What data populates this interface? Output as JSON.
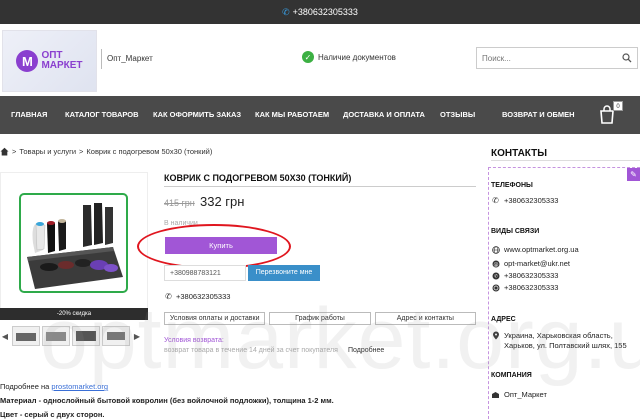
{
  "topbar": {
    "phone": "+380632305333"
  },
  "header": {
    "logo_text_1": "ОПТ",
    "logo_text_2": "МАРКЕТ",
    "brand_name": "Опт_Маркет",
    "docs_label": "Наличие документов",
    "search_placeholder": "Поиск..."
  },
  "nav": {
    "items": [
      "Главная",
      "Каталог товаров",
      "Как оформить заказ",
      "Как мы работаем",
      "Доставка и оплата",
      "Отзывы",
      "Возврат и обмен"
    ],
    "cart_count": "0"
  },
  "breadcrumb": {
    "level1": "Товары и услуги",
    "sep": ">",
    "current": "Коврик с подогревом 50х30 (тонкий)"
  },
  "product": {
    "title": "Коврик с подогревом 50х30 (тонкий)",
    "old_price": "415 грн",
    "price": "332 грн",
    "stock": "В наличии",
    "buy_label": "Купить",
    "phone_input_value": "+380988783121",
    "callback_label": "Перезвоните мне",
    "phone": "+380632305333",
    "discount_label": "-20% скидка",
    "tabs": [
      "Условия оплаты и доставки",
      "График работы",
      "Адрес и контакты"
    ],
    "return_title": "Условия возврата:",
    "return_text": "возврат товара в течение 14 дней за счет покупателя",
    "return_more": "Подробнее"
  },
  "description": {
    "source_prefix": "Подробнее на",
    "source_link": "prostomarket.org",
    "material": "Материал - однослойный бытовой ковролин (без войлочной подложки), толщина 1-2 мм.",
    "color": "Цвет - серый с двух сторон."
  },
  "sidebar": {
    "title": "Контакты",
    "phones_title": "Телефоны",
    "phone": "+380632305333",
    "links_title": "Виды связи",
    "site": "www.optmarket.org.ua",
    "email": "opt-market@ukr.net",
    "viber": "+380632305333",
    "whatsapp": "+380632305333",
    "address_title": "Адрес",
    "address": "Украина, Харьковская область, Харьков, ул. Полтавский шлях, 155",
    "company_title": "Компания",
    "company": "Опт_Маркет"
  },
  "watermark": "optmarket.org.ua",
  "colors": {
    "accent": "#a156d6",
    "nav_bg": "#4a4a4a",
    "topbar_bg": "#333333",
    "callback": "#3a8fc9",
    "annotation": "#e0161f"
  },
  "icons": [
    "phone-icon",
    "check-circle-icon",
    "search-icon",
    "cart-icon",
    "home-icon",
    "globe-icon",
    "email-icon",
    "viber-icon",
    "whatsapp-icon",
    "location-pin-icon",
    "company-icon",
    "edit-pencil-icon",
    "arrow-left-icon",
    "arrow-right-icon"
  ]
}
